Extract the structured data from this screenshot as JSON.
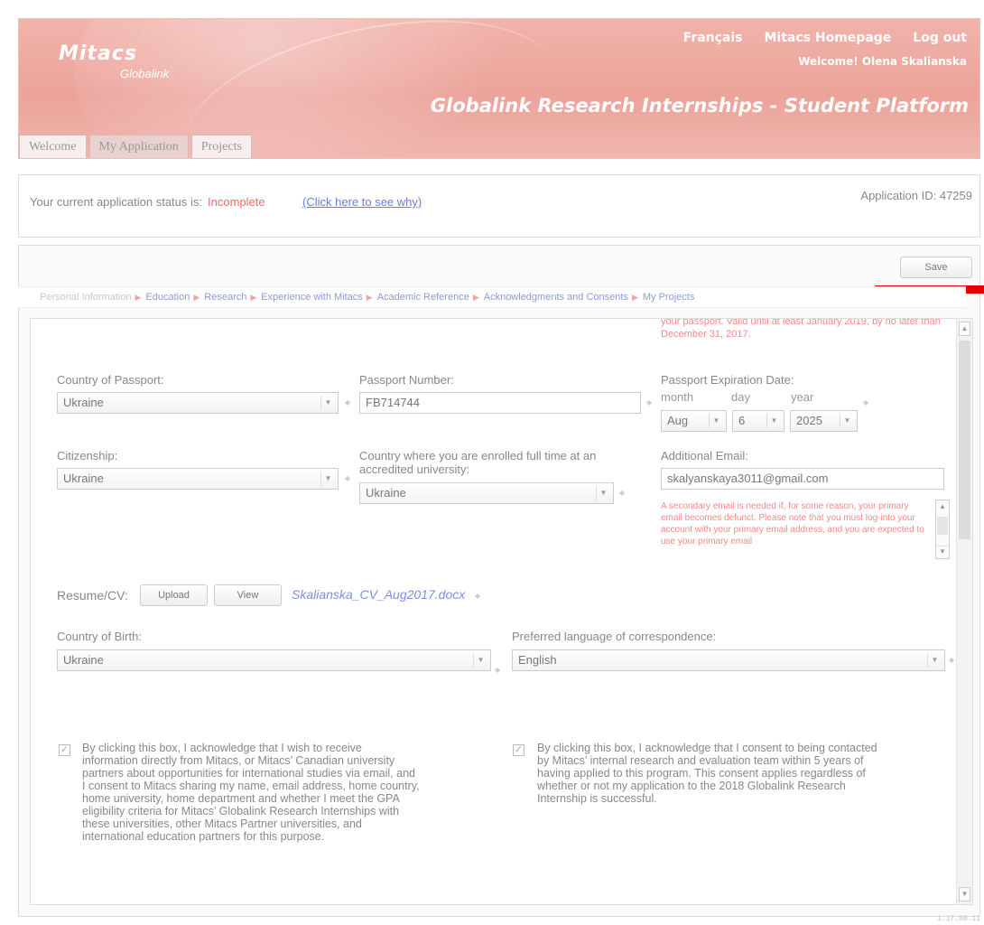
{
  "header": {
    "logo_main": "Mitacs",
    "logo_sub": "Globalink",
    "links": [
      "Français",
      "Mitacs Homepage",
      "Log out"
    ],
    "welcome": "Welcome! Olena Skalianska",
    "platform_title": "Globalink Research Internships - Student Platform",
    "tabs": [
      {
        "label": "Welcome"
      },
      {
        "label": "My Application"
      },
      {
        "label": "Projects"
      }
    ]
  },
  "status": {
    "prefix": "Your current application status is:",
    "value": "Incomplete",
    "link": "(Click here to see why)",
    "app_id": "Application ID: 47259",
    "status_color": "#f46a6a"
  },
  "toolbar": {
    "save_label": "Save"
  },
  "steps": [
    "Personal Information",
    "Education",
    "Research",
    "Experience with Mitacs",
    "Academic Reference",
    "Acknowledgments and Consents",
    "My Projects"
  ],
  "form": {
    "passport_note": "your passport. Valid until at least January 2019, by no later than December 31, 2017.",
    "country_of_passport": {
      "label": "Country of Passport:",
      "value": "Ukraine"
    },
    "passport_number": {
      "label": "Passport Number:",
      "value": "FB714744"
    },
    "passport_expiration": {
      "label": "Passport Expiration Date:",
      "month_label": "month",
      "day_label": "day",
      "year_label": "year",
      "month": "Aug",
      "day": "6",
      "year": "2025"
    },
    "citizenship": {
      "label": "Citizenship:",
      "value": "Ukraine"
    },
    "enrolled_country": {
      "label": "Country where you are enrolled full time at an accredited university:",
      "value": "Ukraine"
    },
    "additional_email": {
      "label": "Additional Email:",
      "value": "skalyanskaya3011@gmail.com",
      "note": "A secondary email is needed if, for some reason, your primary email becomes defunct. Please note that you must log-into your account with your primary email address, and you are expected to use your primary email"
    },
    "resume": {
      "label": "Resume/CV:",
      "upload": "Upload",
      "view": "View",
      "file": "Skalianska_CV_Aug2017.docx"
    },
    "country_of_birth": {
      "label": "Country of Birth:",
      "value": "Ukraine"
    },
    "preferred_language": {
      "label": "Preferred language of correspondence:",
      "value": "English"
    },
    "consent_left": "By clicking this box, I acknowledge that I wish to receive information directly from Mitacs, or Mitacs’ Canadian university partners about opportunities for international studies via email, and I consent to Mitacs sharing my name, email address, home country, home university, home department and whether I meet the GPA eligibility criteria for Mitacs’ Globalink Research Internships with these universities, other Mitacs Partner universities, and international education partners for this purpose.",
    "consent_right": "By clicking this box, I acknowledge that I consent to being contacted by Mitacs’ internal research and evaluation team within 5 years of having applied to this program.  This consent applies regardless of whether or not my application to the 2018 Globalink Research Internship is successful."
  },
  "version": "1.17.08.11",
  "colors": {
    "header_bg": "#eba39a",
    "accent_red": "#e50000",
    "link": "#7e8ee0"
  }
}
